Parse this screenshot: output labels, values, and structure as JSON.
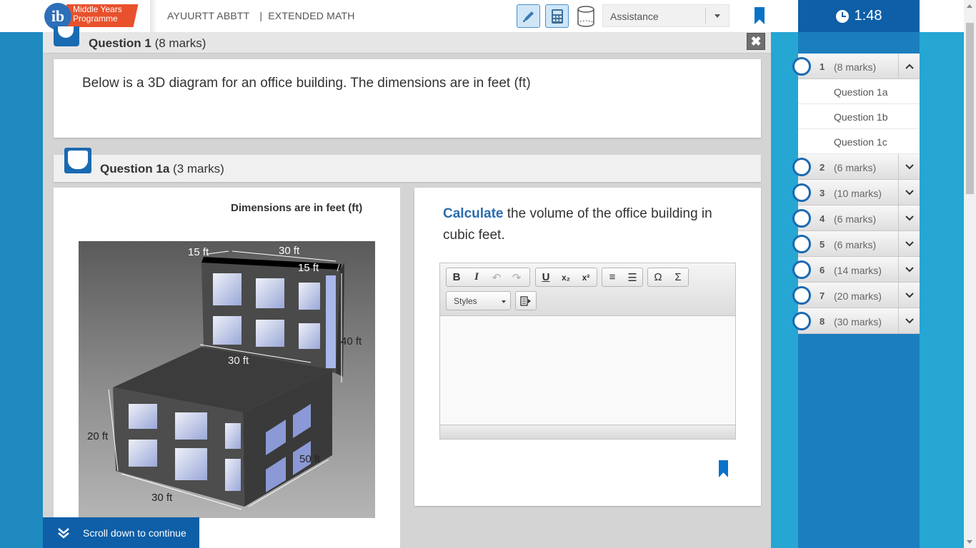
{
  "header": {
    "logo_text_line1": "Middle Years",
    "logo_text_line2": "Programme",
    "logo_glyph": "ib",
    "candidate_name": "AYUURTT ABBTT",
    "subject": "EXTENDED MATH",
    "assistance_label": "Assistance",
    "timer": "1:48",
    "tools": [
      "pen-icon",
      "calculator-icon",
      "cylinder-icon"
    ]
  },
  "question": {
    "number_label": "Question 1",
    "marks": "(8 marks)",
    "stem": "Below is a 3D diagram for an office building. The dimensions are in feet (ft)"
  },
  "subquestion": {
    "number_label": "Question 1a",
    "marks": "(3 marks)",
    "figure_title": "Dimensions are in feet (ft)",
    "command_word": "Calculate",
    "prompt_rest": "the volume of the office building in cubic feet."
  },
  "figure_labels": {
    "top_left_depth": "15 ft",
    "top_width": "30 ft",
    "top_right_depth": "15 ft",
    "upper_height": "40 ft",
    "ledge_width": "30 ft",
    "lower_height": "20 ft",
    "lower_depth": "50 ft",
    "base_width": "30 ft"
  },
  "editor": {
    "bold": "B",
    "italic": "I",
    "undo": "↶",
    "redo": "↷",
    "underline": "U",
    "subscript": "x₂",
    "superscript": "x²",
    "ordered_list": "≡",
    "bullet_list": "☰",
    "omega": "Ω",
    "sigma": "Σ",
    "styles_label": "Styles"
  },
  "scroll_hint": "Scroll down to continue",
  "nav": {
    "questions": [
      {
        "num": "1",
        "marks": "(8 marks)",
        "expanded": true,
        "subs": [
          "Question 1a",
          "Question 1b",
          "Question 1c"
        ]
      },
      {
        "num": "2",
        "marks": "(6 marks)"
      },
      {
        "num": "3",
        "marks": "(10 marks)"
      },
      {
        "num": "4",
        "marks": "(6 marks)"
      },
      {
        "num": "5",
        "marks": "(6 marks)"
      },
      {
        "num": "6",
        "marks": "(14 marks)"
      },
      {
        "num": "7",
        "marks": "(20 marks)"
      },
      {
        "num": "8",
        "marks": "(30 marks)"
      }
    ]
  },
  "colors": {
    "brand_blue": "#0e5fa7",
    "command_blue": "#2b6cb0",
    "side_bg": "#25a6d3",
    "logo_orange": "#e8512c"
  }
}
